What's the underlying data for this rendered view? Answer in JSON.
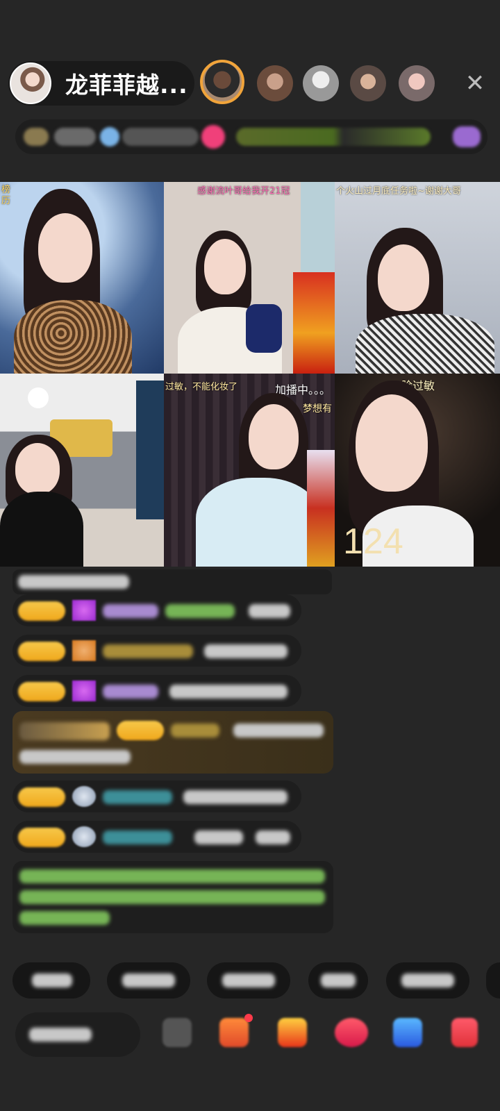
{
  "header": {
    "host_name": "龙菲菲越...",
    "close_glyph": "✕"
  },
  "tiles": [
    {
      "label": "榜",
      "label2": "历",
      "score": ""
    },
    {
      "label": "感谢流叶哥给我开21冠",
      "score": ""
    },
    {
      "label": "个火山过月底任务啦~谢谢大哥",
      "score": ""
    },
    {
      "label": "",
      "score": ""
    },
    {
      "label": "过敏，不能化妆了",
      "label2": "加播中。。。",
      "label3": "梦想有",
      "score": ""
    },
    {
      "label": "脸过敏",
      "score": "124"
    }
  ],
  "colors": {
    "background": "#262626",
    "badge_gold": "#f5b82e",
    "viewer_ring": "#f1a43a"
  }
}
